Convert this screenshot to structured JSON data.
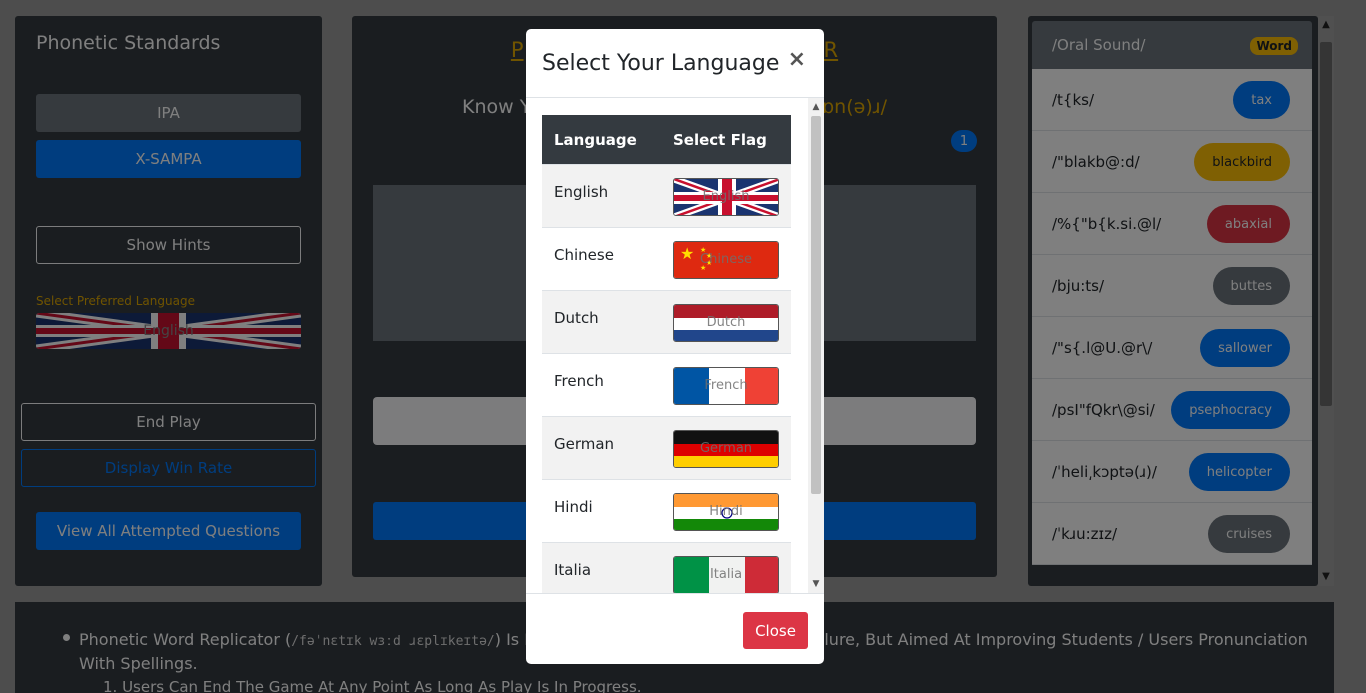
{
  "left": {
    "title": "Phonetic Standards",
    "ipa_label": "IPA",
    "xsampa_label": "X-SAMPA",
    "hints_label": "Show Hints",
    "pref_label": "Select Preferred Language",
    "pref_flag_text": "English",
    "end_label": "End Play",
    "winrate_label": "Display Win Rate",
    "attempted_label": "View All Attempted Questions"
  },
  "center": {
    "title_left": "P",
    "title_right": "R",
    "know_label": "Know Y",
    "ipa_text": "ɒn(ə)ɹ/",
    "badge": "1"
  },
  "right": {
    "header": "/Oral Sound/",
    "header_badge": "Word",
    "items": [
      {
        "sound": "/t{ks/",
        "word": "tax",
        "color": "#007bff",
        "text_color": "#ffffff"
      },
      {
        "sound": "/\"blakb@:d/",
        "word": "blackbird",
        "color": "#ffc107",
        "text_color": "#212529"
      },
      {
        "sound": "/%{\"b{k.si.@l/",
        "word": "abaxial",
        "color": "#dc3545",
        "text_color": "#ffffff"
      },
      {
        "sound": "/bju:ts/",
        "word": "buttes",
        "color": "#6c757d",
        "text_color": "#ffffff"
      },
      {
        "sound": "/\"s{.l@U.@r\\/",
        "word": "sallower",
        "color": "#007bff",
        "text_color": "#ffffff"
      },
      {
        "sound": "/psI\"fQkr\\@si/",
        "word": "psephocracy",
        "color": "#007bff",
        "text_color": "#ffffff"
      },
      {
        "sound": "/ˈheli͵kɔptə(ɹ)/",
        "word": "helicopter",
        "color": "#007bff",
        "text_color": "#ffffff"
      },
      {
        "sound": "/ˈkɹu:zɪz/",
        "word": "cruises",
        "color": "#6c757d",
        "text_color": "#ffffff"
      }
    ]
  },
  "bottom": {
    "line1_a": "Phonetic Word Replicator (",
    "line1_ipa": "/fəˈnɛtɪk wɜːd ɹɛplɪkeɪtə/",
    "line1_b": ") Is Buil",
    "line1_c": "ck Failure, But Aimed At Improving Students / Users Pronunciation",
    "line2": "With Spellings.",
    "line3": "1. Users Can End The Game At Any Point As Long As Play Is In Progress."
  },
  "modal": {
    "title": "Select Your Language",
    "close_x": "×",
    "col_language": "Language",
    "col_flag": "Select Flag",
    "languages": [
      {
        "name": "English",
        "flag_text": "English",
        "flag": "uk"
      },
      {
        "name": "Chinese",
        "flag_text": "Chinese",
        "flag": "cn"
      },
      {
        "name": "Dutch",
        "flag_text": "Dutch",
        "flag": "nl"
      },
      {
        "name": "French",
        "flag_text": "French",
        "flag": "fr"
      },
      {
        "name": "German",
        "flag_text": "German",
        "flag": "de"
      },
      {
        "name": "Hindi",
        "flag_text": "Hindi",
        "flag": "in"
      },
      {
        "name": "Italia",
        "flag_text": "Italia",
        "flag": "it"
      }
    ],
    "close_label": "Close"
  }
}
